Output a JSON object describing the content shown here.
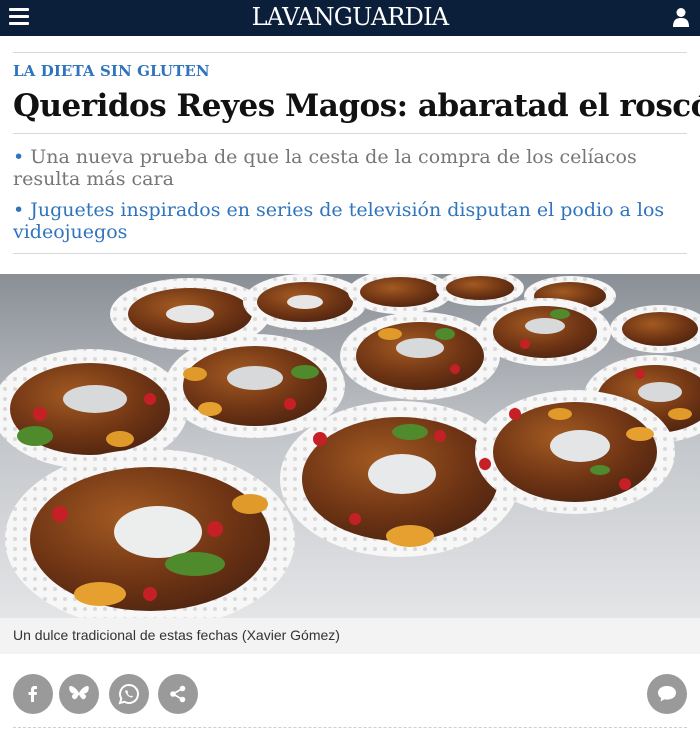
{
  "header": {
    "brand": "LAVANGUARDIA",
    "menu_icon": "hamburger-icon",
    "account_icon": "user-icon",
    "background": "#0b1f3b"
  },
  "article": {
    "kicker": "LA DIETA SIN GLUTEN",
    "headline": "Queridos Reyes Magos: abaratad el roscón",
    "related": [
      {
        "bullet": "•",
        "text": "Una nueva prueba de que la cesta de la compra de los celíacos resulta más cara"
      },
      {
        "bullet": "•",
        "text": "Juguetes inspirados en series de televisión disputan el podio a los videojuegos"
      }
    ],
    "accent_color": "#2f74bd"
  },
  "photo": {
    "caption": "Un dulce tradicional de estas fechas",
    "credit": "(Xavier Gómez)"
  },
  "share": {
    "buttons": [
      "facebook-icon",
      "bluesky-icon",
      "whatsapp-icon",
      "share-icon"
    ],
    "comments_icon": "comment-icon"
  }
}
